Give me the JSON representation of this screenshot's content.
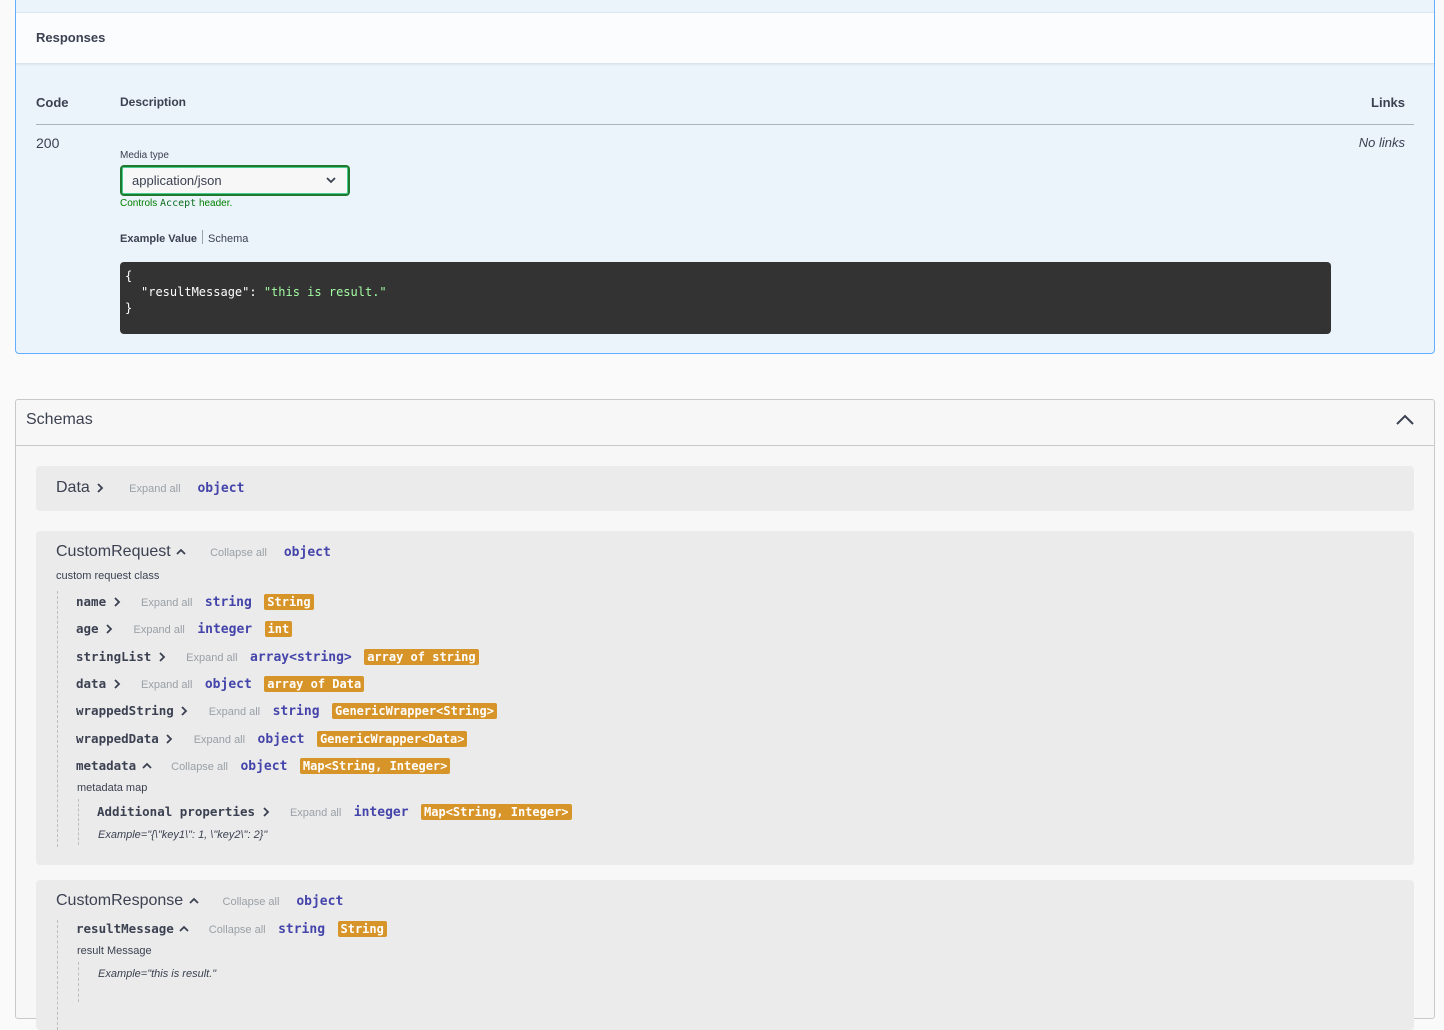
{
  "responses": {
    "title": "Responses",
    "columns": {
      "code": "Code",
      "description": "Description",
      "links": "Links"
    },
    "row": {
      "code": "200",
      "media_type_label": "Media type",
      "media_type_value": "application/json",
      "controls_prefix": "Controls",
      "controls_code": "Accept",
      "controls_suffix": "header.",
      "tab_example": "Example Value",
      "tab_schema": "Schema",
      "links_value": "No links",
      "example_open": "{",
      "example_key": "\"resultMessage\"",
      "example_colon": ": ",
      "example_value": "\"this is result.\"",
      "example_close": "}"
    }
  },
  "schemas": {
    "title": "Schemas",
    "data_model": {
      "name": "Data",
      "toggle": "Expand all",
      "type": "object"
    },
    "custom_request": {
      "name": "CustomRequest",
      "toggle": "Collapse all",
      "type": "object",
      "description": "custom request class",
      "properties": [
        {
          "name": "name",
          "toggle": "Expand all",
          "type": "string",
          "format": "String"
        },
        {
          "name": "age",
          "toggle": "Expand all",
          "type": "integer",
          "format": "int"
        },
        {
          "name": "stringList",
          "toggle": "Expand all",
          "type": "array<string>",
          "format": "array of string"
        },
        {
          "name": "data",
          "toggle": "Expand all",
          "type": "object",
          "format": "array of Data"
        },
        {
          "name": "wrappedString",
          "toggle": "Expand all",
          "type": "string",
          "format": "GenericWrapper<String>"
        },
        {
          "name": "wrappedData",
          "toggle": "Expand all",
          "type": "object",
          "format": "GenericWrapper<Data>"
        },
        {
          "name": "metadata",
          "toggle": "Collapse all",
          "type": "object",
          "format": "Map<String, Integer>"
        }
      ],
      "metadata_description": "metadata map",
      "additional": {
        "name": "Additional properties",
        "toggle": "Expand all",
        "type": "integer",
        "format": "Map<String, Integer>"
      },
      "metadata_example": "Example=\"{\\\"key1\\\": 1, \\\"key2\\\": 2}\""
    },
    "custom_response": {
      "name": "CustomResponse",
      "toggle": "Collapse all",
      "type": "object",
      "property": {
        "name": "resultMessage",
        "toggle": "Collapse all",
        "type": "string",
        "format": "String"
      },
      "property_description": "result Message",
      "property_example": "Example=\"this is result.\""
    }
  },
  "colors": {
    "blue_border": "#61affe",
    "format_badge": "#d79428",
    "type_text": "#4444aa",
    "code_bg": "#333333"
  },
  "icons": [
    "chevron-down-icon",
    "chevron-up-icon",
    "chevron-right-icon"
  ]
}
